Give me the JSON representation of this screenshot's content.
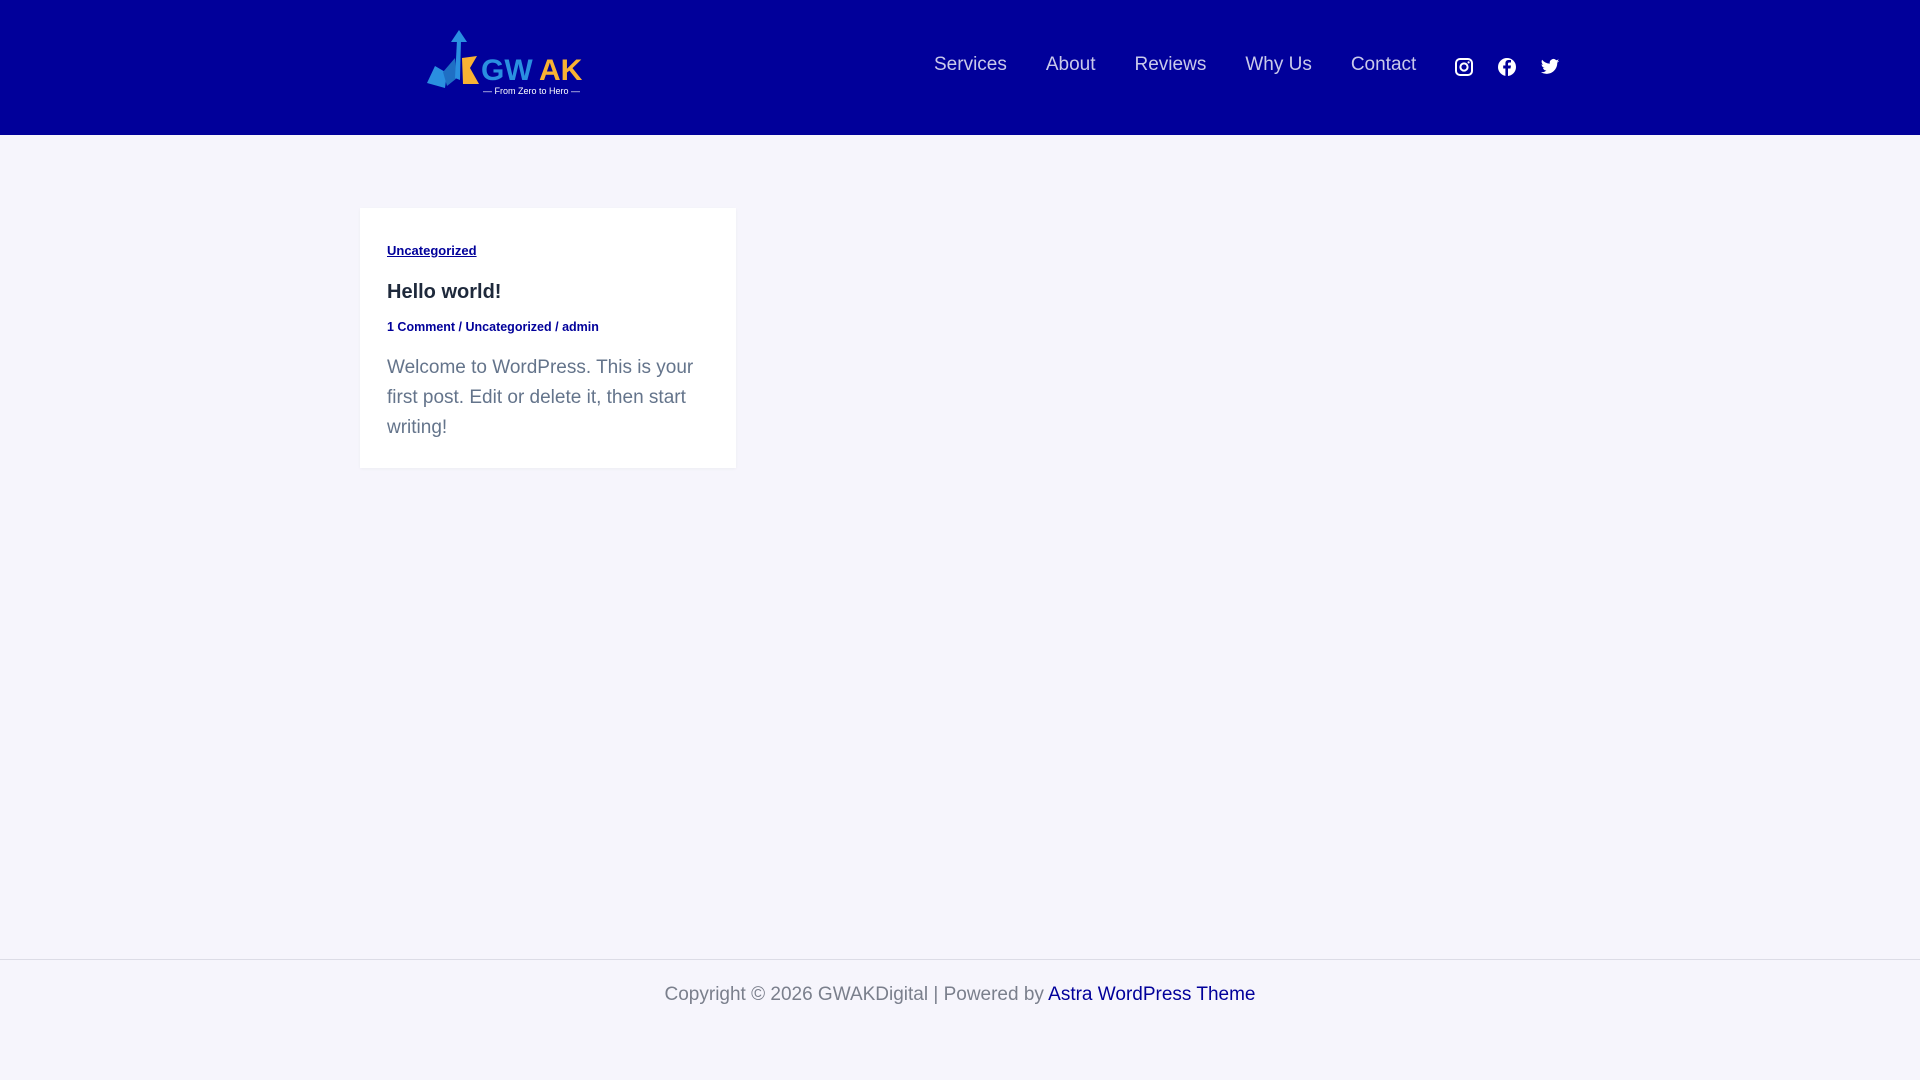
{
  "header": {
    "logo": {
      "text": "GWAK",
      "tagline": "From Zero to Hero"
    },
    "nav": [
      "Services",
      "About",
      "Reviews",
      "Why Us",
      "Contact"
    ],
    "social": [
      "instagram-icon",
      "facebook-icon",
      "twitter-icon"
    ]
  },
  "post": {
    "category": "Uncategorized",
    "title": "Hello world!",
    "meta": {
      "comments": "1 Comment",
      "category": "Uncategorized",
      "author": "admin",
      "separator": " / "
    },
    "excerpt": "Welcome to WordPress. This is your first post. Edit or delete it, then start writing!"
  },
  "footer": {
    "copyright": "Copyright © 2026 GWAKDigital | Powered by ",
    "theme_link": "Astra WordPress Theme"
  },
  "colors": {
    "brand": "#01009a",
    "accent": "#f9b233",
    "logo_blue": "#2a8fe0"
  }
}
